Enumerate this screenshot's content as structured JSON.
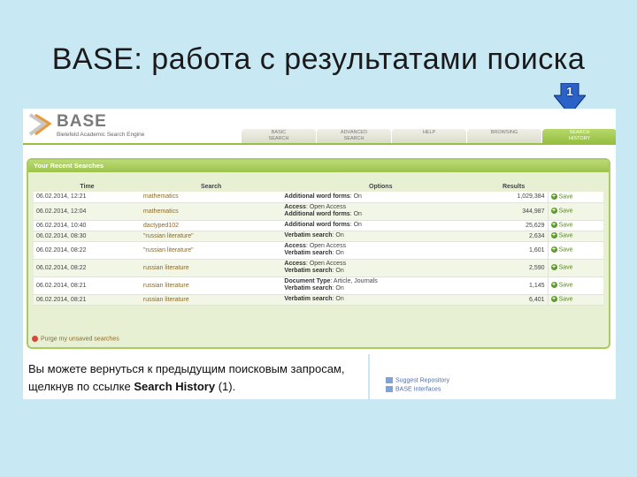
{
  "slide": {
    "title": "BASE: работа с результатами поиска",
    "marker_number": "1",
    "caption_prefix": "Вы можете вернуться к предыдущим поисковым запросам, щелкнув по ссылке ",
    "caption_link": "Search History",
    "caption_suffix": " (1)."
  },
  "header": {
    "logo_text": "BASE",
    "logo_subtitle": "Bielefeld Academic Search Engine",
    "tabs": [
      {
        "line1": "BASIC",
        "line2": "SEARCH"
      },
      {
        "line1": "ADVANCED",
        "line2": "SEARCH"
      },
      {
        "line1": "HELP",
        "line2": ""
      },
      {
        "line1": "BROWSING",
        "line2": ""
      },
      {
        "line1": "SEARCH",
        "line2": "HISTORY"
      }
    ]
  },
  "panel": {
    "title": "Your Recent Searches",
    "columns": [
      "Time",
      "Search",
      "Options",
      "Results",
      ""
    ],
    "save_label": "Save",
    "purge_label": "Purge my unsaved searches",
    "rows": [
      {
        "time": "06.02.2014, 12:21",
        "search": "mathematics",
        "options": [
          {
            "k": "Additional word forms",
            "v": ": On"
          }
        ],
        "results": "1,029,384"
      },
      {
        "time": "06.02.2014, 12:04",
        "search": "mathematics",
        "options": [
          {
            "k": "Access",
            "v": ": Open Access"
          },
          {
            "k": "Additional word forms",
            "v": ": On"
          }
        ],
        "results": "344,987"
      },
      {
        "time": "06.02.2014, 10:40",
        "search": "dactyped102",
        "options": [
          {
            "k": "Additional word forms",
            "v": ": On"
          }
        ],
        "results": "25,629"
      },
      {
        "time": "06.02.2014, 08:30",
        "search": "\"russian literature\"",
        "options": [
          {
            "k": "Verbatim search",
            "v": ": On"
          }
        ],
        "results": "2,634"
      },
      {
        "time": "06.02.2014, 08:22",
        "search": "\"russian literature\"",
        "options": [
          {
            "k": "Access",
            "v": ": Open Access"
          },
          {
            "k": "Verbatim search",
            "v": ": On"
          }
        ],
        "results": "1,601"
      },
      {
        "time": "06.02.2014, 08:22",
        "search": "russian literature",
        "options": [
          {
            "k": "Access",
            "v": ": Open Access"
          },
          {
            "k": "Verbatim search",
            "v": ": On"
          }
        ],
        "results": "2,590"
      },
      {
        "time": "06.02.2014, 08:21",
        "search": "russian literature",
        "options": [
          {
            "k": "Document Type",
            "v": ": Article, Journals"
          },
          {
            "k": "Verbatim search",
            "v": ": On"
          }
        ],
        "results": "1,145"
      },
      {
        "time": "06.02.2014, 08:21",
        "search": "russian literature",
        "options": [
          {
            "k": "Verbatim search",
            "v": ": On"
          }
        ],
        "results": "6,401"
      }
    ]
  },
  "sidebar": {
    "links": [
      "Suggest Repository",
      "BASE Interfaces"
    ]
  },
  "colors": {
    "background": "#c8e8f4",
    "accent_green": "#96c043",
    "arrow_blue": "#2a62c8"
  }
}
